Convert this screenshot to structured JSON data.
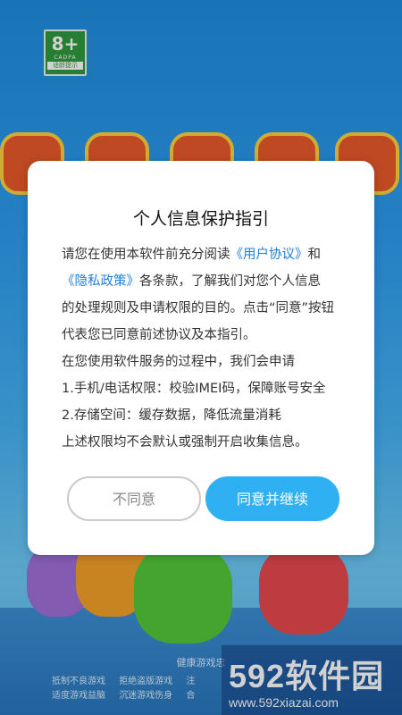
{
  "rating_badge": {
    "age": "8+",
    "org": "CADPA",
    "tip": "适龄提示"
  },
  "dialog": {
    "title": "个人信息保护指引",
    "line1_prefix": "请您在使用本软件前充分阅读",
    "link_user_agreement": "《用户协议》",
    "line1_suffix": "和",
    "link_privacy_policy": "《隐私政策》",
    "line2_suffix": "各条款，了解我们对您个人信息",
    "line3": "的处理规则及申请权限的目的。点击“同意”按钮",
    "line4": "代表您已同意前述协议及本指引。",
    "line5": "在您使用软件服务的过程中，我们会申请",
    "line6": "1.手机/电话权限：校验IMEI码，保障账号安全",
    "line7": "2.存储空间：缓存数据，降低流量消耗",
    "line8": "上述权限均不会默认或强制开启收集信息。",
    "decline_label": "不同意",
    "accept_label": "同意并继续"
  },
  "footer": {
    "title": "健康游戏忠",
    "row1": [
      "抵制不良游戏",
      "拒绝盗版游戏",
      "注"
    ],
    "row2": [
      "适度游戏益脑",
      "沉迷游戏伤身",
      "合"
    ]
  },
  "watermark": {
    "brand": "592软件园",
    "url": "www.592xiazai.com"
  }
}
